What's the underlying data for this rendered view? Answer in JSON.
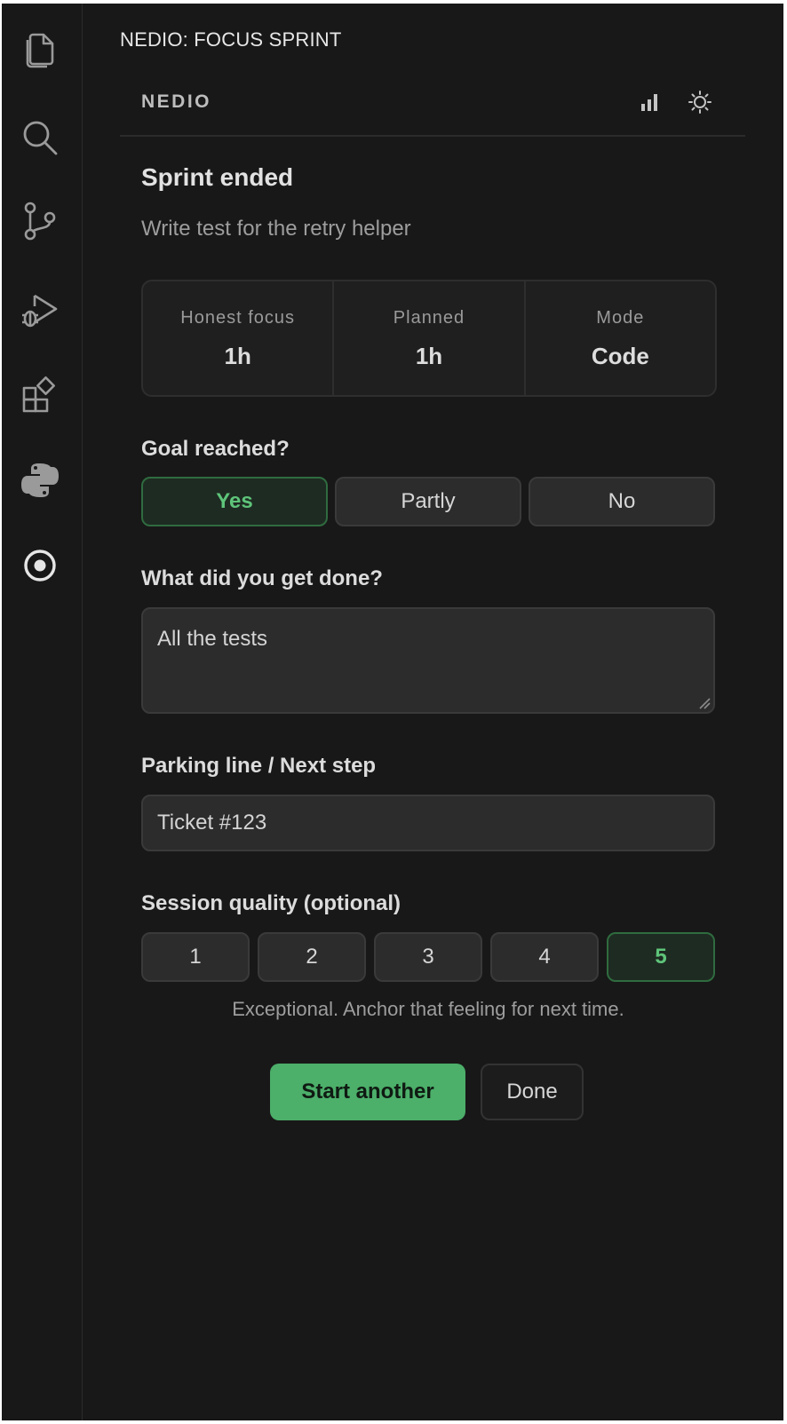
{
  "panel": {
    "title": "NEDIO: FOCUS SPRINT"
  },
  "activity_bar": {
    "items": [
      {
        "icon": "files-icon"
      },
      {
        "icon": "search-icon"
      },
      {
        "icon": "source-control-icon"
      },
      {
        "icon": "run-debug-icon"
      },
      {
        "icon": "extensions-icon"
      },
      {
        "icon": "python-icon"
      },
      {
        "icon": "nedio-target-icon"
      }
    ]
  },
  "section": {
    "label": "NEDIO",
    "icons": [
      "stats-icon",
      "theme-sun-icon"
    ]
  },
  "summary": {
    "heading": "Sprint ended",
    "task": "Write test for the retry helper",
    "stats": [
      {
        "label": "Honest focus",
        "value": "1h"
      },
      {
        "label": "Planned",
        "value": "1h"
      },
      {
        "label": "Mode",
        "value": "Code"
      }
    ]
  },
  "goal": {
    "question": "Goal reached?",
    "options": [
      "Yes",
      "Partly",
      "No"
    ],
    "selected": "Yes"
  },
  "done": {
    "question": "What did you get done?",
    "value": "All the tests"
  },
  "parking": {
    "question": "Parking line / Next step",
    "value": "Ticket #123"
  },
  "quality": {
    "question": "Session quality (optional)",
    "options": [
      "1",
      "2",
      "3",
      "4",
      "5"
    ],
    "selected": "5",
    "hint": "Exceptional. Anchor that feeling for next time."
  },
  "actions": {
    "primary": "Start another",
    "secondary": "Done"
  },
  "colors": {
    "accent": "#4caf6a",
    "background": "#181818"
  }
}
